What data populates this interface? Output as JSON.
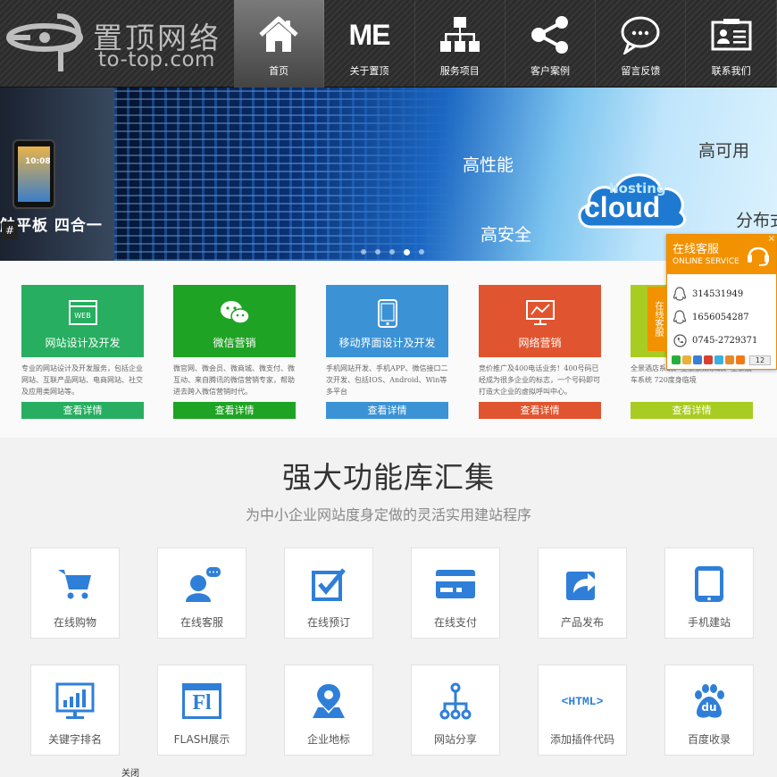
{
  "logo": {
    "cn": "置顶网络",
    "en": "to-top.com"
  },
  "nav": [
    {
      "label": "首页",
      "icon": "home-icon",
      "active": true
    },
    {
      "label": "关于置顶",
      "icon": "me-text",
      "text": "ME"
    },
    {
      "label": "服务项目",
      "icon": "sitemap-icon"
    },
    {
      "label": "客户案例",
      "icon": "share-icon"
    },
    {
      "label": "留言反馈",
      "icon": "chat-bubble-icon"
    },
    {
      "label": "联系我们",
      "icon": "contact-card-icon"
    }
  ],
  "banner": {
    "caption": "触平板 四合一",
    "hash": "#",
    "words": [
      "高性能",
      "高可用",
      "高安全",
      "分布式"
    ],
    "cloud_small": "hosting",
    "cloud_big": "cloud",
    "tablet_time": "10:08",
    "slides": 5,
    "active_slide": 3
  },
  "services": [
    {
      "title": "网站设计及开发",
      "icon": "web-icon",
      "icon_text": "WEB",
      "color": "#27ae60",
      "desc": "专业的网站设计及开发服务，包括企业网站、互联产品网站、电商网站、社交及应用类网站等。",
      "button": "查看详情"
    },
    {
      "title": "微信营销",
      "icon": "wechat-icon",
      "color": "#1fa324",
      "desc": "微官网、微会员、微商城、微支付、微互动、来自腾讯的微信营销专家，帮助进去跨入微信营销时代。",
      "button": "查看详情"
    },
    {
      "title": "移动界面设计及开发",
      "icon": "mobile-icon",
      "color": "#3b93d6",
      "desc": "手机网站开发、手机APP、微信接口二次开发、包括IOS、Android、Win等多平台",
      "button": "查看详情"
    },
    {
      "title": "网络营销",
      "icon": "monitor-chart-icon",
      "color": "#e0552f",
      "desc": "竞价推广及400电话业务！400号码已经成为很多企业的标志，一个号码即可打造大企业的虚拟呼叫中心。",
      "button": "查看详情"
    },
    {
      "title": "",
      "icon": "",
      "color": "#a9cc22",
      "desc": "全景酒店系统、全景景点系统、全景展车系统 720度身临境",
      "button": "查看详情"
    }
  ],
  "features": {
    "title": "强大功能库汇集",
    "subtitle": "为中小企业网站度身定做的灵活实用建站程序",
    "items": [
      {
        "label": "在线购物",
        "icon": "cart-icon"
      },
      {
        "label": "在线客服",
        "icon": "customer-service-icon"
      },
      {
        "label": "在线预订",
        "icon": "checkbox-icon"
      },
      {
        "label": "在线支付",
        "icon": "credit-card-icon"
      },
      {
        "label": "产品发布",
        "icon": "publish-icon"
      },
      {
        "label": "手机建站",
        "icon": "tablet-icon"
      },
      {
        "label": "关键字排名",
        "icon": "bar-chart-icon"
      },
      {
        "label": "FLASH展示",
        "icon": "flash-icon",
        "icon_text": "Fl"
      },
      {
        "label": "企业地标",
        "icon": "location-pin-icon"
      },
      {
        "label": "网站分享",
        "icon": "share-tree-icon"
      },
      {
        "label": "添加插件代码",
        "icon": "html-code-icon",
        "icon_text": "<HTML>"
      },
      {
        "label": "百度收录",
        "icon": "baidu-icon",
        "icon_text": "du"
      }
    ]
  },
  "close_label": "关闭",
  "online_service": {
    "title": "在线客服",
    "subtitle": "ONLINE SERVICE",
    "tab": "在线客服",
    "close": "×",
    "qq": [
      "314531949",
      "1656054287"
    ],
    "phone": "0745-2729371",
    "share_count": "12"
  },
  "colors": {
    "accent_blue": "#2f7fd8",
    "orange": "#f39200",
    "header": "#2c2c2c"
  }
}
